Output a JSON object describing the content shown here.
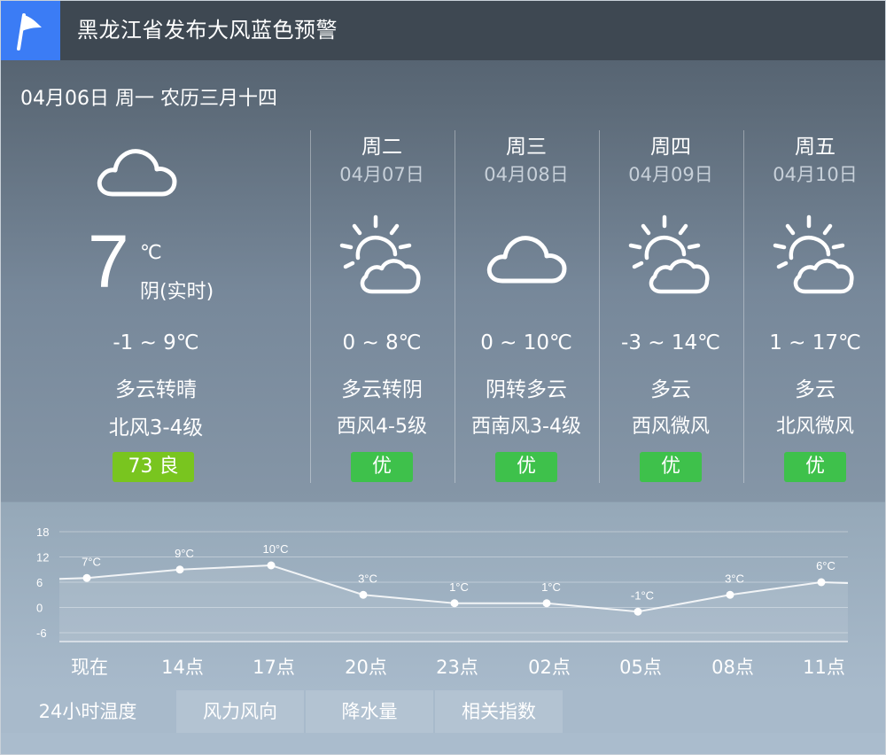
{
  "header": {
    "title": "黑龙江省发布大风蓝色预警",
    "flag_color": "#3b7cf5"
  },
  "date_line": "04月06日 周一 农历三月十四",
  "today": {
    "icon": "cloud-icon",
    "temp": "7",
    "unit": "℃",
    "desc": "阴(实时)",
    "range": "-1 ~ 9℃",
    "weather": "多云转晴",
    "wind": "北风3-4级",
    "aqi": "73  良",
    "aqi_color": "#79c51f"
  },
  "forecast": [
    {
      "name": "周二",
      "date": "04月07日",
      "icon": "partly-cloudy-icon",
      "range": "0 ~ 8℃",
      "weather": "多云转阴",
      "wind": "西风4-5级",
      "aqi": "优"
    },
    {
      "name": "周三",
      "date": "04月08日",
      "icon": "cloud-icon",
      "range": "0 ~ 10℃",
      "weather": "阴转多云",
      "wind": "西南风3-4级",
      "aqi": "优"
    },
    {
      "name": "周四",
      "date": "04月09日",
      "icon": "partly-cloudy-icon",
      "range": "-3 ~ 14℃",
      "weather": "多云",
      "wind": "西风微风",
      "aqi": "优"
    },
    {
      "name": "周五",
      "date": "04月10日",
      "icon": "partly-cloudy-icon",
      "range": "1 ~ 17℃",
      "weather": "多云",
      "wind": "北风微风",
      "aqi": "优"
    }
  ],
  "aqi_good_color": "#3ec14b",
  "chart_data": {
    "type": "line",
    "categories": [
      "现在",
      "14点",
      "17点",
      "20点",
      "23点",
      "02点",
      "05点",
      "08点",
      "11点"
    ],
    "values": [
      7,
      9,
      10,
      3,
      1,
      1,
      -1,
      3,
      6
    ],
    "labels": [
      "7°C",
      "9°C",
      "10°C",
      "3°C",
      "1°C",
      "1°C",
      "-1°C",
      "3°C",
      "6°C"
    ],
    "yticks": [
      "18",
      "12",
      "6",
      "0",
      "-6"
    ],
    "ylim": [
      -6,
      18
    ],
    "grid": true
  },
  "tabs": [
    {
      "label": "24小时温度",
      "active": true
    },
    {
      "label": "风力风向",
      "active": false
    },
    {
      "label": "降水量",
      "active": false
    },
    {
      "label": "相关指数",
      "active": false
    }
  ]
}
